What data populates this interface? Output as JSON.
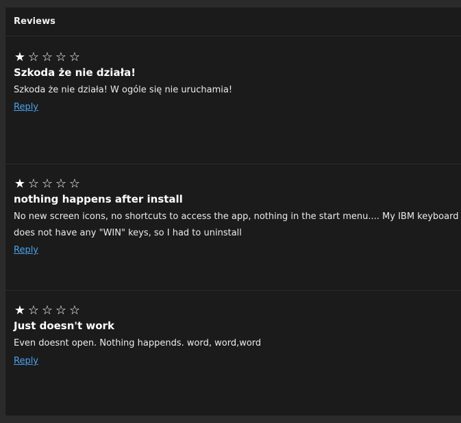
{
  "header": {
    "title": "Reviews"
  },
  "reviews": [
    {
      "rating": 1,
      "stars": [
        "★",
        "☆",
        "☆",
        "☆",
        "☆"
      ],
      "title": "Szkoda że nie działa!",
      "body": "Szkoda że nie działa! W ogóle się nie uruchamia!",
      "reply_label": "Reply"
    },
    {
      "rating": 1,
      "stars": [
        "★",
        "☆",
        "☆",
        "☆",
        "☆"
      ],
      "title": "nothing happens after install",
      "body": "No new screen icons, no shortcuts to access the app, nothing in the start menu.... My IBM keyboard does not have any \"WIN\" keys, so I had to uninstall",
      "reply_label": "Reply"
    },
    {
      "rating": 1,
      "stars": [
        "★",
        "☆",
        "☆",
        "☆",
        "☆"
      ],
      "title": "Just doesn't work",
      "body": "Even doesnt open. Nothing happends. word, word,word",
      "reply_label": "Reply"
    }
  ]
}
